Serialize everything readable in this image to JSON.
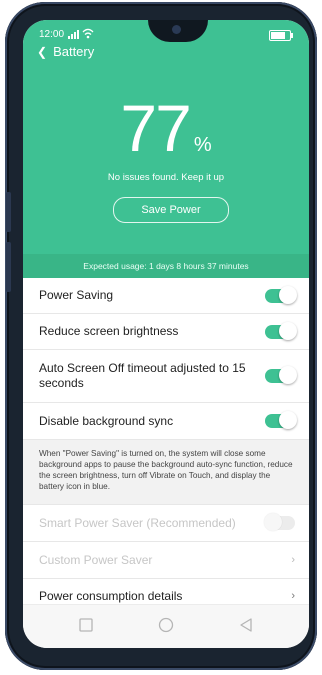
{
  "status_bar": {
    "time": "12:00",
    "signal_icon": "signal-icon",
    "wifi_icon": "wifi-icon",
    "battery_icon": "battery-icon"
  },
  "header": {
    "back_label": "Battery",
    "battery_percent": "77",
    "percent_sign": "%",
    "status_text": "No issues found. Keep it up",
    "save_power_label": "Save Power",
    "expected_usage": "Expected usage: 1 days 8 hours 37 minutes"
  },
  "settings": {
    "power_saving": {
      "label": "Power Saving",
      "on": true
    },
    "reduce_brightness": {
      "label": "Reduce screen brightness",
      "on": true
    },
    "auto_screen_off": {
      "label": "Auto Screen Off timeout adjusted to 15 seconds",
      "on": true
    },
    "disable_bg_sync": {
      "label": "Disable background sync",
      "on": true
    },
    "description": "When \"Power Saving\" is turned on, the system will close some background apps to pause the background auto-sync function, reduce the screen brightness, turn off Vibrate on Touch, and display the battery icon in blue.",
    "smart_power_saver": {
      "label": "Smart Power Saver (Recommended)",
      "on": false
    },
    "custom_power_saver": {
      "label": "Custom Power Saver"
    },
    "power_consumption": {
      "label": "Power consumption details"
    }
  },
  "navbar": {
    "recents": "square-icon",
    "home": "circle-icon",
    "back": "triangle-back-icon"
  },
  "colors": {
    "accent": "#3ec193",
    "accent_dark": "#39b587"
  }
}
